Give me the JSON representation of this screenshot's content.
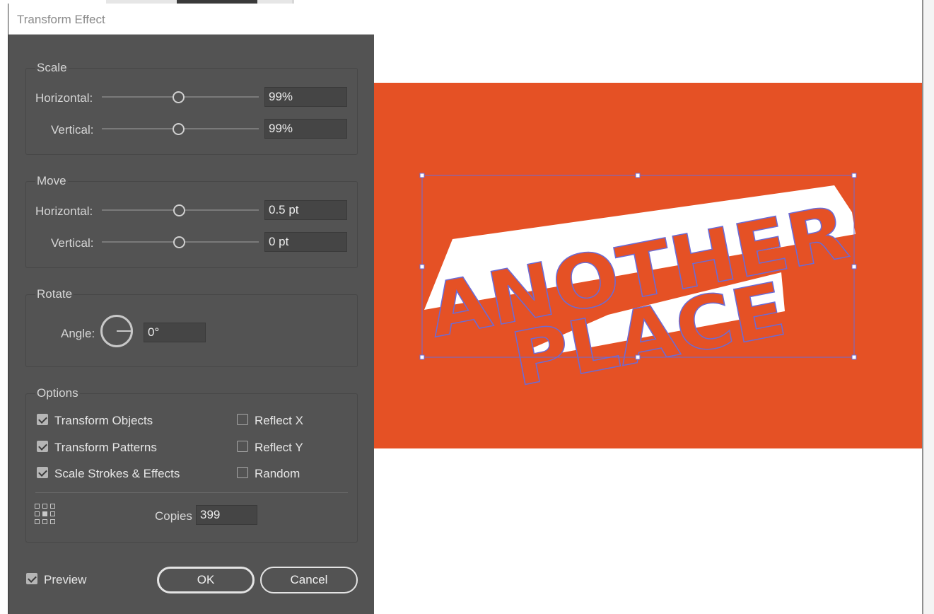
{
  "dialog": {
    "title": "Transform Effect",
    "scale": {
      "label": "Scale",
      "horizontal_label": "Horizontal:",
      "horizontal_value": "99%",
      "vertical_label": "Vertical:",
      "vertical_value": "99%"
    },
    "move": {
      "label": "Move",
      "horizontal_label": "Horizontal:",
      "horizontal_value": "0.5 pt",
      "vertical_label": "Vertical:",
      "vertical_value": "0 pt"
    },
    "rotate": {
      "label": "Rotate",
      "angle_label": "Angle:",
      "angle_value": "0°"
    },
    "options": {
      "label": "Options",
      "transform_objects": "Transform Objects",
      "transform_patterns": "Transform Patterns",
      "scale_strokes": "Scale Strokes & Effects",
      "reflect_x": "Reflect X",
      "reflect_y": "Reflect Y",
      "random": "Random",
      "copies_label": "Copies",
      "copies_value": "399"
    },
    "preview_label": "Preview",
    "ok_label": "OK",
    "cancel_label": "Cancel"
  },
  "canvas": {
    "background_color": "#e55125",
    "selection_color": "#6b6bd6",
    "artwork_line1": "ANOTHER",
    "artwork_line2": "PLACE"
  },
  "icons": {
    "reference_point": "reference-point-grid-icon",
    "angle_dial": "angle-dial-icon",
    "checkbox": "checkmark-icon"
  }
}
